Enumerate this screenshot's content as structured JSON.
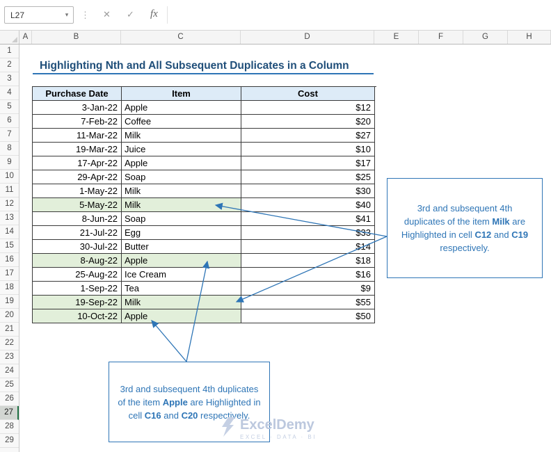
{
  "formula_bar": {
    "name_box": "L27",
    "fx_label": "fx"
  },
  "icons": {
    "dropdown": "▾",
    "dots": "⋮",
    "cancel": "✕",
    "enter": "✓"
  },
  "sheet": {
    "columns": [
      "A",
      "B",
      "C",
      "D",
      "E",
      "F",
      "G",
      "H"
    ],
    "visible_rows": 29,
    "selected_row": 27
  },
  "title": "Highlighting Nth and All Subsequent Duplicates in a Column",
  "table": {
    "headers": [
      "Purchase Date",
      "Item",
      "Cost"
    ],
    "rows": [
      {
        "date": "3-Jan-22",
        "item": "Apple",
        "cost": "$12",
        "highlight": false
      },
      {
        "date": "7-Feb-22",
        "item": "Coffee",
        "cost": "$20",
        "highlight": false
      },
      {
        "date": "11-Mar-22",
        "item": "Milk",
        "cost": "$27",
        "highlight": false
      },
      {
        "date": "19-Mar-22",
        "item": "Juice",
        "cost": "$10",
        "highlight": false
      },
      {
        "date": "17-Apr-22",
        "item": "Apple",
        "cost": "$17",
        "highlight": false
      },
      {
        "date": "29-Apr-22",
        "item": "Soap",
        "cost": "$25",
        "highlight": false
      },
      {
        "date": "1-May-22",
        "item": "Milk",
        "cost": "$30",
        "highlight": false
      },
      {
        "date": "5-May-22",
        "item": "Milk",
        "cost": "$40",
        "highlight": true
      },
      {
        "date": "8-Jun-22",
        "item": "Soap",
        "cost": "$41",
        "highlight": false
      },
      {
        "date": "21-Jul-22",
        "item": "Egg",
        "cost": "$33",
        "highlight": false
      },
      {
        "date": "30-Jul-22",
        "item": "Butter",
        "cost": "$14",
        "highlight": false
      },
      {
        "date": "8-Aug-22",
        "item": "Apple",
        "cost": "$18",
        "highlight": true
      },
      {
        "date": "25-Aug-22",
        "item": "Ice Cream",
        "cost": "$16",
        "highlight": false
      },
      {
        "date": "1-Sep-22",
        "item": "Tea",
        "cost": "$9",
        "highlight": false
      },
      {
        "date": "19-Sep-22",
        "item": "Milk",
        "cost": "$55",
        "highlight": true
      },
      {
        "date": "10-Oct-22",
        "item": "Apple",
        "cost": "$50",
        "highlight": true
      }
    ]
  },
  "callouts": {
    "milk": {
      "segments": [
        {
          "text": "3rd and subsequent 4th duplicates of the item "
        },
        {
          "text": "Milk",
          "bold": true
        },
        {
          "text": " are Highlighted in cell "
        },
        {
          "text": "C12",
          "bold": true
        },
        {
          "text": " and "
        },
        {
          "text": "C19",
          "bold": true
        },
        {
          "text": " respectively."
        }
      ]
    },
    "apple": {
      "segments": [
        {
          "text": "3rd and subsequent 4th duplicates of the item "
        },
        {
          "text": "Apple",
          "bold": true
        },
        {
          "text": " are Highlighted in cell "
        },
        {
          "text": "C16",
          "bold": true
        },
        {
          "text": " and "
        },
        {
          "text": "C20",
          "bold": true
        },
        {
          "text": " respectively."
        }
      ]
    }
  },
  "watermark": {
    "name": "ExcelDemy",
    "tagline": "EXCEL · DATA · BI"
  },
  "colors": {
    "accent_blue": "#2E75B6",
    "title_blue": "#1F4E79",
    "header_fill": "#DDEBF7",
    "highlight_green": "#E2EFDA",
    "watermark_blue": "#BFCBE0"
  }
}
